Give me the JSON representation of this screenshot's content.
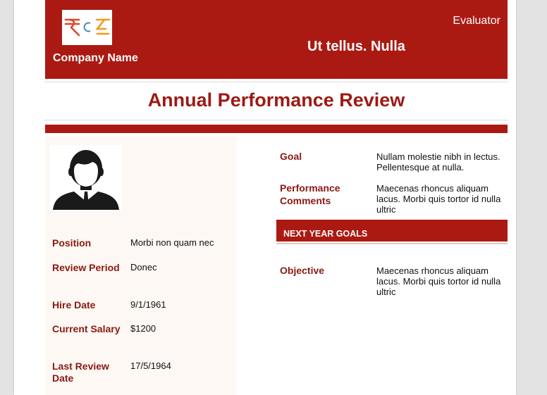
{
  "header": {
    "company_name": "Company Name",
    "evaluator_label": "Evaluator",
    "evaluator_name": "Ut tellus. Nulla",
    "logo_icon": "currency-logo-icon"
  },
  "title": "Annual Performance Review",
  "employee": {
    "avatar_icon": "person-avatar-icon",
    "fields": [
      {
        "label": "Position",
        "value": "Morbi non quam nec"
      },
      {
        "label": "Review Period",
        "value": "Donec"
      },
      {
        "label": "Hire Date",
        "value": "9/1/1961"
      },
      {
        "label": "Current Salary",
        "value": "$1200"
      },
      {
        "label": "Last Review Date",
        "value": "17/5/1964"
      }
    ]
  },
  "review": {
    "goal_label": "Goal",
    "goal_value": "Nullam molestie nibh in lectus. Pellentesque at nulla.",
    "comments_label": "Performance Comments",
    "comments_value": "Maecenas rhoncus aliquam lacus. Morbi quis tortor id nulla ultric"
  },
  "next_year": {
    "section_title": "NEXT YEAR GOALS",
    "objective_label": "Objective",
    "objective_value": "Maecenas rhoncus aliquam lacus. Morbi quis tortor id nulla ultric"
  },
  "colors": {
    "brand_red": "#ab1a12",
    "label_red": "#8a1912",
    "panel_bg": "#fdf8f3"
  }
}
